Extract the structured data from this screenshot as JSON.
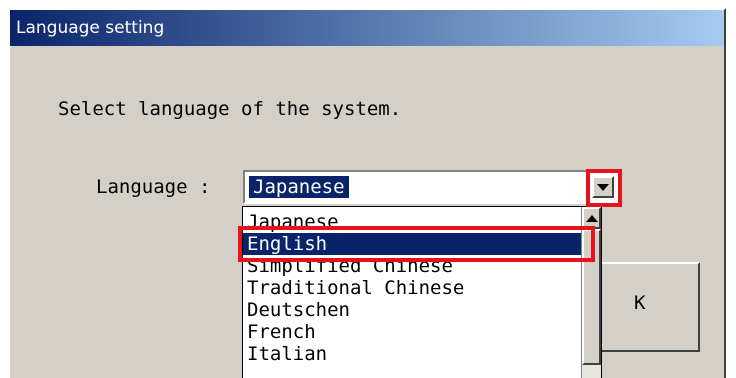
{
  "window": {
    "title": "Language setting"
  },
  "prompt": "Select language of the system.",
  "language": {
    "label": "Language :",
    "selected_value": "Japanese",
    "options": [
      "Japanese",
      "English",
      "Simplified Chinese",
      "Traditional Chinese",
      "Deutschen",
      "French",
      "Italian"
    ],
    "highlighted_index": 1
  },
  "ok_button": {
    "label": "K"
  },
  "icons": {
    "dropdown": "chevron-down-icon",
    "scroll_up": "chevron-up-icon"
  },
  "colors": {
    "title_gradient_start": "#0a246a",
    "title_gradient_end": "#a6caf0",
    "selection": "#0a246a",
    "dialog_bg": "#d4d0c8",
    "annotation_red": "#e8121e"
  }
}
